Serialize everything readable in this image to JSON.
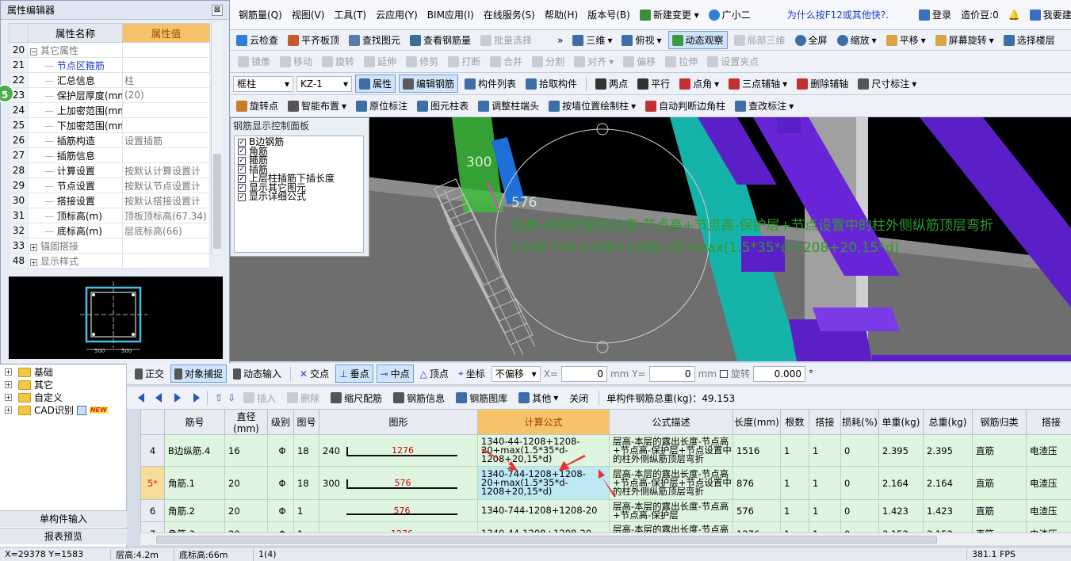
{
  "menu": {
    "items": [
      "钢筋量(Q)",
      "视图(V)",
      "工具(T)",
      "云应用(Y)",
      "BIM应用(I)",
      "在线服务(S)",
      "帮助(H)",
      "版本号(B)",
      "新建变更",
      "广小二"
    ],
    "notice": "为什么按F12或其他快?.",
    "login": "登录",
    "coins": "造价豆:0",
    "suggest": "我要建议"
  },
  "toolbar1": {
    "items": [
      "云检查",
      "平齐板顶",
      "查找图元",
      "查看钢筋量",
      "批量选择"
    ],
    "view_items": [
      "三维",
      "俯视",
      "动态观察",
      "局部三维",
      "全屏",
      "缩放",
      "平移",
      "屏幕旋转",
      "选择楼层"
    ]
  },
  "toolbar2": {
    "items": [
      "镜像",
      "移动",
      "旋转",
      "延伸",
      "修剪",
      "打断",
      "合并",
      "分割",
      "对齐",
      "偏移",
      "拉伸",
      "设置夹点"
    ]
  },
  "toolbar3": {
    "element_type": "框柱",
    "element_name": "KZ-1",
    "items": [
      "属性",
      "编辑钢筋",
      "构件列表",
      "拾取构件",
      "两点",
      "平行",
      "点角",
      "三点辅轴",
      "删除辅轴",
      "尺寸标注"
    ]
  },
  "toolbar4": {
    "items": [
      "旋转点",
      "智能布置",
      "原位标注",
      "图元柱表",
      "调整柱端头",
      "按墙位置绘制柱",
      "自动判断边角柱",
      "查改标注"
    ]
  },
  "property_editor": {
    "title": "属性编辑器",
    "col_name": "属性名称",
    "col_value": "属性值",
    "rows": [
      {
        "num": "20",
        "name": "其它属性",
        "value": "",
        "tree": "−",
        "indent": 0,
        "blue": false
      },
      {
        "num": "21",
        "name": "节点区箍筋",
        "value": "",
        "indent": 1,
        "blue": true
      },
      {
        "num": "22",
        "name": "汇总信息",
        "value": "柱",
        "indent": 1,
        "blue": false
      },
      {
        "num": "23",
        "name": "保护层厚度(mm)",
        "value": "(20)",
        "indent": 1,
        "blue": false
      },
      {
        "num": "24",
        "name": "上加密范围(mm)",
        "value": "",
        "indent": 1,
        "blue": false
      },
      {
        "num": "25",
        "name": "下加密范围(mm)",
        "value": "",
        "indent": 1,
        "blue": false
      },
      {
        "num": "26",
        "name": "插筋构造",
        "value": "设置插筋",
        "indent": 1,
        "blue": false
      },
      {
        "num": "27",
        "name": "插筋信息",
        "value": "",
        "indent": 1,
        "blue": false
      },
      {
        "num": "28",
        "name": "计算设置",
        "value": "按默认计算设置计",
        "indent": 1,
        "blue": false
      },
      {
        "num": "29",
        "name": "节点设置",
        "value": "按默认节点设置计",
        "indent": 1,
        "blue": false
      },
      {
        "num": "30",
        "name": "搭接设置",
        "value": "按默认搭接设置计",
        "indent": 1,
        "blue": false
      },
      {
        "num": "31",
        "name": "顶标高(m)",
        "value": "顶板顶标高(67.34)",
        "indent": 1,
        "blue": false
      },
      {
        "num": "32",
        "name": "底标高(m)",
        "value": "层底标高(66)",
        "indent": 1,
        "blue": false
      },
      {
        "num": "33",
        "name": "锚固搭接",
        "value": "",
        "tree": "+",
        "indent": 0,
        "blue": false
      },
      {
        "num": "48",
        "name": "显示样式",
        "value": "",
        "tree": "+",
        "indent": 0,
        "blue": false
      }
    ],
    "preview_dims": [
      "500",
      "500"
    ]
  },
  "side_badge": "5",
  "control_panel": {
    "title": "钢筋显示控制面板",
    "items": [
      "B边钢筋",
      "角筋",
      "箍筋",
      "插筋",
      "上层柱插筋下插长度",
      "显示其它图元",
      "显示详细公式"
    ]
  },
  "view3d": {
    "dim1": "300",
    "dim2": "576",
    "formula_desc": "层高-本层的露出长度-节点高+节点高-保护层+节点设置中的柱外侧纵筋顶层弯折",
    "formula": "1340-744-1208+1208-20+max(1.5*35*d-1208+20,15*d)",
    "colors": {
      "green_text": "#3aa43a",
      "purple": "#5b1fc8",
      "teal": "#14a8a0",
      "gray": "#7a7a7a"
    }
  },
  "tree": {
    "items": [
      "基础",
      "其它",
      "自定义",
      "CAD识别"
    ],
    "new_badge": "NEW"
  },
  "left_buttons": {
    "single": "单构件输入",
    "report": "报表预览"
  },
  "snapbar": {
    "items": [
      "正交",
      "对象捕捉",
      "动态输入",
      "交点",
      "垂点",
      "中点",
      "顶点",
      "坐标"
    ],
    "offset": "不偏移",
    "x_label": "X=",
    "x_value": "0",
    "y_label": "mm Y=",
    "y_value": "0",
    "unit": "mm",
    "rotate_label": "旋转",
    "rotate_value": "0.000",
    "deg": "°"
  },
  "grid_toolbar": {
    "items": [
      "插入",
      "删除",
      "缩尺配筋",
      "钢筋信息",
      "钢筋图库",
      "其他",
      "关闭"
    ],
    "total_label": "单构件钢筋总重(kg)：49.153"
  },
  "grid": {
    "headers": [
      "筋号",
      "直径(mm)",
      "级别",
      "图号",
      "图形",
      "计算公式",
      "公式描述",
      "长度(mm)",
      "根数",
      "搭接",
      "损耗(%)",
      "单重(kg)",
      "总重(kg)",
      "钢筋归类",
      "搭接"
    ],
    "rows": [
      {
        "rn": "4",
        "current": false,
        "name": "B边纵筋.4",
        "dia": "16",
        "grade": "Φ",
        "fig": "18",
        "shape_left": "240",
        "shape_val": "1276",
        "formula": "1340-44-1208+1208-20+max(1.5*35*d-1208+20,15*d)",
        "desc": "层高-本层的露出长度-节点高+节点高-保护层+节点设置中的柱外侧纵筋顶层弯折",
        "len": "1516",
        "count": "1",
        "lap": "1",
        "loss": "0",
        "unit_w": "2.395",
        "total_w": "2.395",
        "cls": "直筋",
        "conn": "电渣压"
      },
      {
        "rn": "5*",
        "current": true,
        "name": "角筋.1",
        "dia": "20",
        "grade": "Φ",
        "fig": "18",
        "shape_left": "300",
        "shape_val": "576",
        "formula": "1340-744-1208+1208-20+max(1.5*35*d-1208+20,15*d)",
        "desc": "层高-本层的露出长度-节点高+节点高-保护层+节点设置中的柱外侧纵筋顶层弯折",
        "len": "876",
        "count": "1",
        "lap": "1",
        "loss": "0",
        "unit_w": "2.164",
        "total_w": "2.164",
        "cls": "直筋",
        "conn": "电渣压"
      },
      {
        "rn": "6",
        "current": false,
        "name": "角筋.2",
        "dia": "20",
        "grade": "Φ",
        "fig": "1",
        "shape_left": "",
        "shape_val": "576",
        "formula": "1340-744-1208+1208-20",
        "desc": "层高-本层的露出长度-节点高+节点高-保护层",
        "len": "576",
        "count": "1",
        "lap": "1",
        "loss": "0",
        "unit_w": "1.423",
        "total_w": "1.423",
        "cls": "直筋",
        "conn": "电渣压"
      },
      {
        "rn": "7",
        "current": false,
        "name": "角筋.3",
        "dia": "20",
        "grade": "Φ",
        "fig": "1",
        "shape_left": "",
        "shape_val": "1276",
        "formula": "1340-44-1208+1208-20",
        "desc": "层高-本层的露出长度-节点高+节点高-保护层",
        "len": "1276",
        "count": "1",
        "lap": "1",
        "loss": "0",
        "unit_w": "3.152",
        "total_w": "3.152",
        "cls": "直筋",
        "conn": "电渣压"
      }
    ]
  },
  "status": {
    "coord": "X=29378 Y=1583",
    "floor_h": "层高:4.2m",
    "bottom_h": "底标高:66m",
    "sel": "1(4)",
    "fps": "381.1 FPS"
  }
}
